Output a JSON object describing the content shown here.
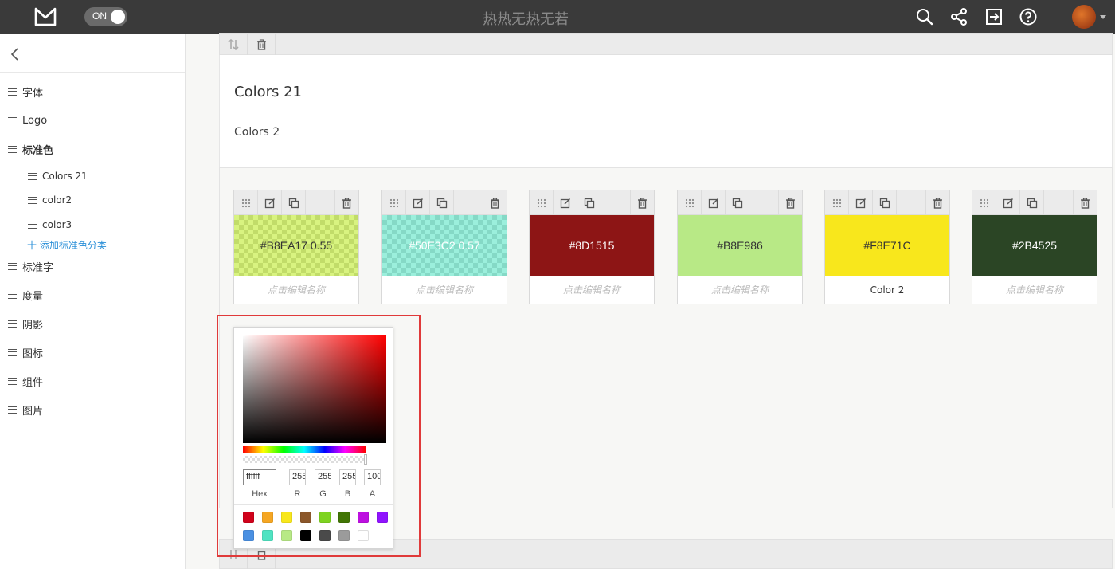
{
  "app": {
    "title": "热热无热无若",
    "toggle_label": "ON"
  },
  "sidebar": {
    "items": [
      {
        "label": "字体"
      },
      {
        "label": "Logo"
      },
      {
        "label": "标准色"
      },
      {
        "label": "标准字"
      },
      {
        "label": "度量"
      },
      {
        "label": "阴影"
      },
      {
        "label": "图标"
      },
      {
        "label": "组件"
      },
      {
        "label": "图片"
      }
    ],
    "sub_items": [
      {
        "label": "Colors 21"
      },
      {
        "label": "color2"
      },
      {
        "label": "color3"
      }
    ],
    "add_category": "十 添加标准色分类"
  },
  "main": {
    "card_title": "Colors 21",
    "card_subtitle": "Colors 2",
    "swatches": [
      {
        "hex": "#B8EA17 0.55",
        "color": "#B8EA17",
        "alpha": 0.55,
        "name": "点击编辑名称",
        "text_color": "#333333"
      },
      {
        "hex": "#50E3C2 0.57",
        "color": "#50E3C2",
        "alpha": 0.57,
        "name": "点击编辑名称",
        "text_color": "#ffffff"
      },
      {
        "hex": "#8D1515",
        "color": "#8D1515",
        "alpha": 1,
        "name": "点击编辑名称",
        "text_color": "#ffffff"
      },
      {
        "hex": "#B8E986",
        "color": "#B8E986",
        "alpha": 1,
        "name": "点击编辑名称",
        "text_color": "#333333"
      },
      {
        "hex": "#F8E71C",
        "color": "#F8E71C",
        "alpha": 1,
        "name": "Color 2",
        "text_color": "#333333"
      },
      {
        "hex": "#2B4525",
        "color": "#2B4525",
        "alpha": 1,
        "name": "点击编辑名称",
        "text_color": "#ffffff"
      }
    ]
  },
  "picker": {
    "hex_value": "ffffff",
    "r": "255",
    "g": "255",
    "b": "255",
    "a": "100",
    "labels": {
      "hex": "Hex",
      "r": "R",
      "g": "G",
      "b": "B",
      "a": "A"
    },
    "presets": [
      "#D0021B",
      "#F5A623",
      "#F8E71C",
      "#8B572A",
      "#7ED321",
      "#417505",
      "#BD10E0",
      "#9013FE",
      "#4A90E2",
      "#50E3C2",
      "#B8E986",
      "#000000",
      "#4A4A4A",
      "#9B9B9B",
      "#FFFFFF"
    ]
  },
  "icons": [
    "logo-icon",
    "search-icon",
    "share-icon",
    "export-icon",
    "help-icon",
    "drag-icon",
    "edit-icon",
    "copy-icon",
    "delete-icon",
    "sort-icon"
  ]
}
